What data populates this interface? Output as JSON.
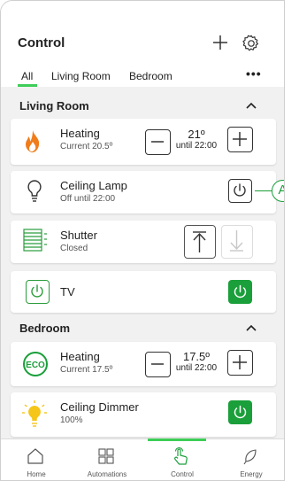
{
  "header": {
    "title": "Control",
    "add_icon": "plus-icon",
    "settings_icon": "gear-icon"
  },
  "tabs": [
    {
      "label": "All",
      "active": true
    },
    {
      "label": "Living Room",
      "active": false
    },
    {
      "label": "Bedroom",
      "active": false
    }
  ],
  "tabs_more": "•••",
  "sections": {
    "living_room": {
      "title": "Living Room",
      "devices": {
        "heating": {
          "name": "Heating",
          "status": "Current 20.5º",
          "setpoint": "21º",
          "until": "until 22:00",
          "icon": "flame-icon"
        },
        "lamp": {
          "name": "Ceiling Lamp",
          "status": "Off until 22:00",
          "icon": "light-bulb-icon"
        },
        "shutter": {
          "name": "Shutter",
          "status": "Closed",
          "icon": "shutter-icon"
        },
        "tv": {
          "name": "TV",
          "icon": "power-icon"
        }
      }
    },
    "bedroom": {
      "title": "Bedroom",
      "devices": {
        "heating": {
          "name": "Heating",
          "status": "Current 17.5º",
          "setpoint": "17.5º",
          "until": "until 22:00",
          "icon": "eco-icon"
        },
        "dimmer": {
          "name": "Ceiling Dimmer",
          "status": "100%",
          "icon": "light-bulb-on-icon"
        }
      }
    }
  },
  "callout": "A",
  "nav": [
    {
      "label": "Home",
      "icon": "home-icon"
    },
    {
      "label": "Automations",
      "icon": "grid-icon"
    },
    {
      "label": "Control",
      "icon": "hand-touch-icon",
      "active": true
    },
    {
      "label": "Energy",
      "icon": "leaf-icon"
    }
  ],
  "colors": {
    "accent": "#3dcd58",
    "power_green": "#1a9f3a",
    "flame_orange": "#f07c1a",
    "bulb_yellow": "#f5c518",
    "background": "#f1f1f1"
  }
}
